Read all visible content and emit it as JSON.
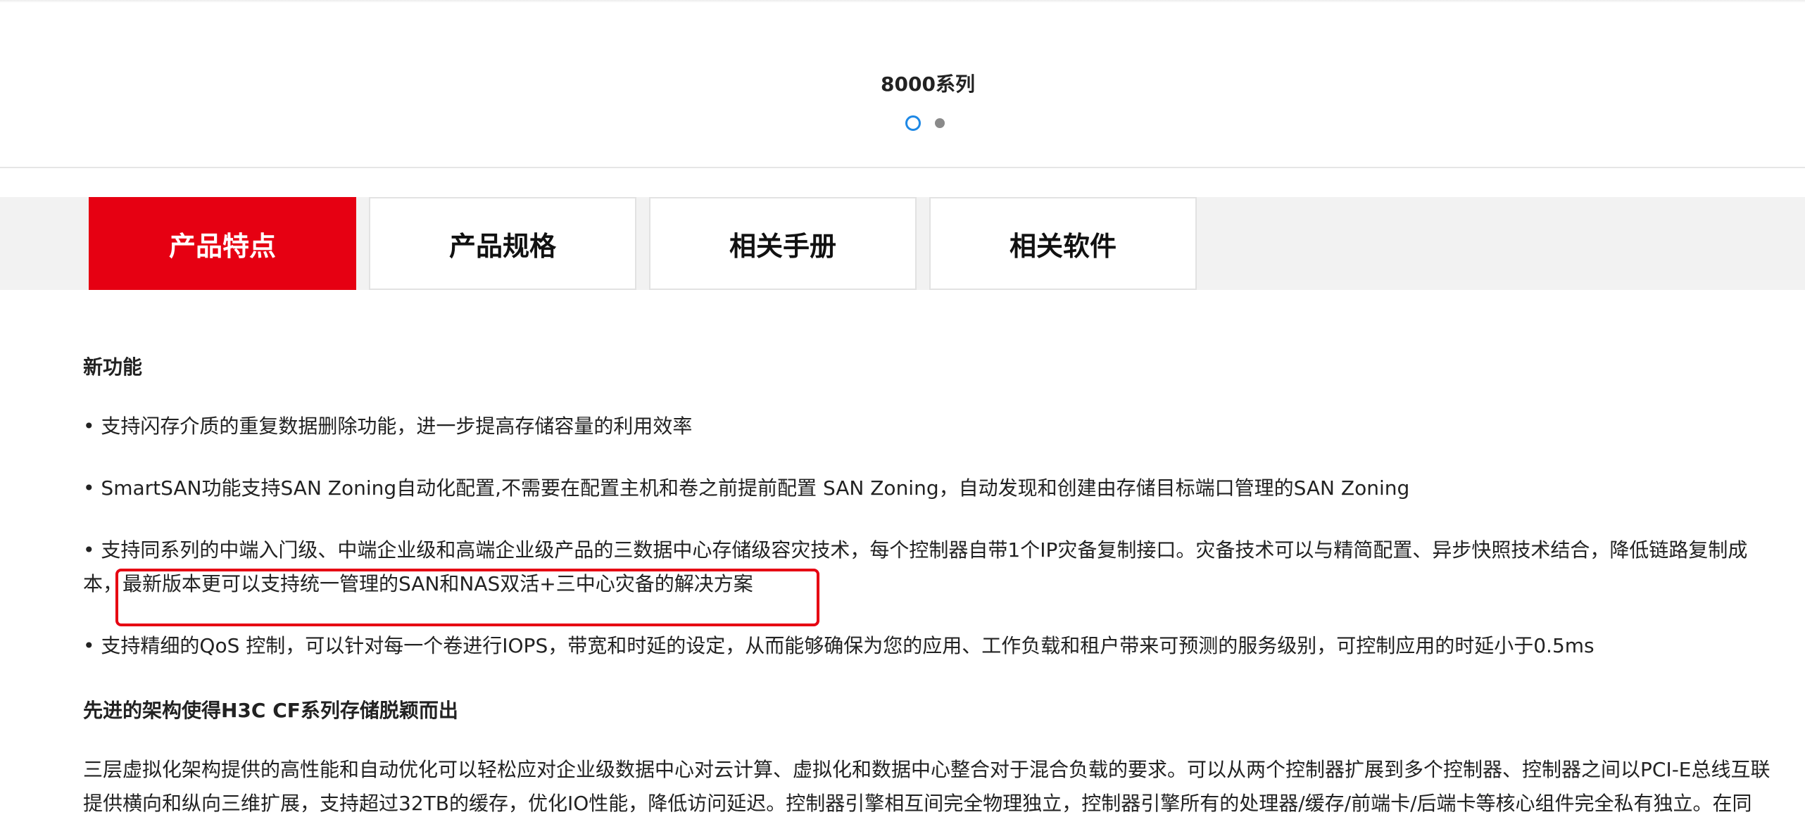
{
  "carousel": {
    "title": "8000系列",
    "dot_count": 2,
    "active_index": 0
  },
  "tabs": [
    {
      "label": "产品特点",
      "active": true
    },
    {
      "label": "产品规格",
      "active": false
    },
    {
      "label": "相关手册",
      "active": false
    },
    {
      "label": "相关软件",
      "active": false
    }
  ],
  "content": {
    "section1_title": "新功能",
    "bullets": [
      "• 支持闪存介质的重复数据删除功能，进一步提高存储容量的利用效率",
      "• SmartSAN功能支持SAN Zoning自动化配置,不需要在配置主机和卷之前提前配置 SAN Zoning，自动发现和创建由存储目标端口管理的SAN Zoning",
      "• 支持同系列的中端入门级、中端企业级和高端企业级产品的三数据中心存储级容灾技术，每个控制器自带1个IP灾备复制接口。灾备技术可以与精简配置、异步快照技术结合，降低链路复制成本，最新版本更可以支持统一管理的SAN和NAS双活+三中心灾备的解决方案",
      "• 支持精细的QoS 控制，可以针对每一个卷进行IOPS，带宽和时延的设定，从而能够确保为您的应用、工作负载和租户带来可预测的服务级别，可控制应用的时延小于0.5ms"
    ],
    "section2_title": "先进的架构使得H3C CF系列存储脱颖而出",
    "section2_text": "三层虚拟化架构提供的高性能和自动优化可以轻松应对企业级数据中心对云计算、虚拟化和数据中心整合对于混合负载的要求。可以从两个控制器扩展到多个控制器、控制器之间以PCI-E总线互联提供横向和纵向三维扩展，支持超过32TB的缓存，优化IO性能，降低访问延迟。控制器引擎相互间完全物理独立，控制器引擎所有的处理器/缓存/前端卡/后端卡等核心组件完全私有独立。在同"
  },
  "colors": {
    "accent_red": "#e60012",
    "dot_active_blue": "#1e88e5",
    "text": "#222222",
    "tab_bar_bg": "#f2f2f2"
  }
}
